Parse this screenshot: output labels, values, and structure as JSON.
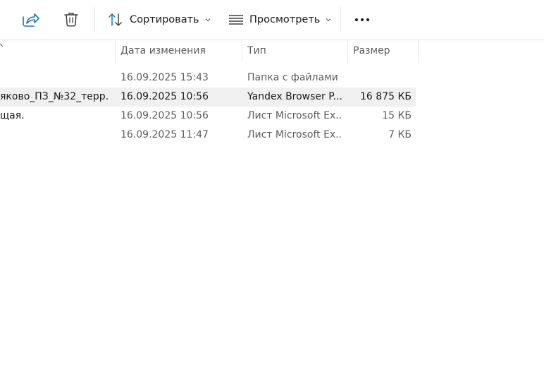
{
  "toolbar": {
    "share_icon": "share-icon",
    "delete_icon": "trash-icon",
    "sort_label": "Сортировать",
    "view_label": "Просмотреть",
    "more_icon": "more-icon"
  },
  "columns": {
    "date": "Дата изменения",
    "type": "Тип",
    "size": "Размер"
  },
  "rows": [
    {
      "name": "",
      "date": "16.09.2025 15:43",
      "type": "Папка с файлами",
      "size": ""
    },
    {
      "name": "яково_ПЗ_№32_терр...",
      "date": "16.09.2025 10:56",
      "type": "Yandex Browser P...",
      "size": "16 875 КБ"
    },
    {
      "name": "щая.",
      "date": "16.09.2025 10:56",
      "type": "Лист Microsoft Ex...",
      "size": "15 КБ"
    },
    {
      "name": "",
      "date": "16.09.2025 11:47",
      "type": "Лист Microsoft Ex...",
      "size": "7 КБ"
    }
  ],
  "colors": {
    "accent": "#1a73b8",
    "selected_row": "#f0f0f0",
    "secondary_text": "#5d5d5d"
  }
}
